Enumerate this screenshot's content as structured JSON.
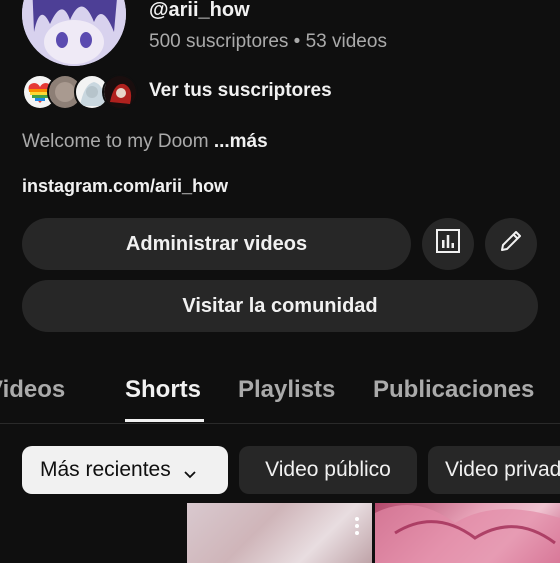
{
  "channel": {
    "handle": "@arii_how",
    "stats": "500 suscriptores • 53 videos",
    "subscribers_label": "Ver tus suscriptores",
    "description": "Welcome to my Doom",
    "description_more": "...más",
    "link": "instagram.com/arii_how"
  },
  "actions": {
    "manage_videos": "Administrar videos",
    "visit_community": "Visitar la comunidad",
    "analytics_icon": "analytics-icon",
    "edit_icon": "pencil-icon"
  },
  "tabs": [
    {
      "label": "Videos",
      "active": false
    },
    {
      "label": "Shorts",
      "active": true
    },
    {
      "label": "Playlists",
      "active": false
    },
    {
      "label": "Publicaciones",
      "active": false
    }
  ],
  "chips": [
    {
      "label": "Más recientes",
      "selected": true
    },
    {
      "label": "Video público",
      "selected": false
    },
    {
      "label": "Video privado",
      "selected": false
    }
  ],
  "colors": {
    "background": "#0f0f0f",
    "surface": "#272727",
    "text_primary": "#f1f1f1",
    "text_secondary": "#aaaaaa"
  }
}
